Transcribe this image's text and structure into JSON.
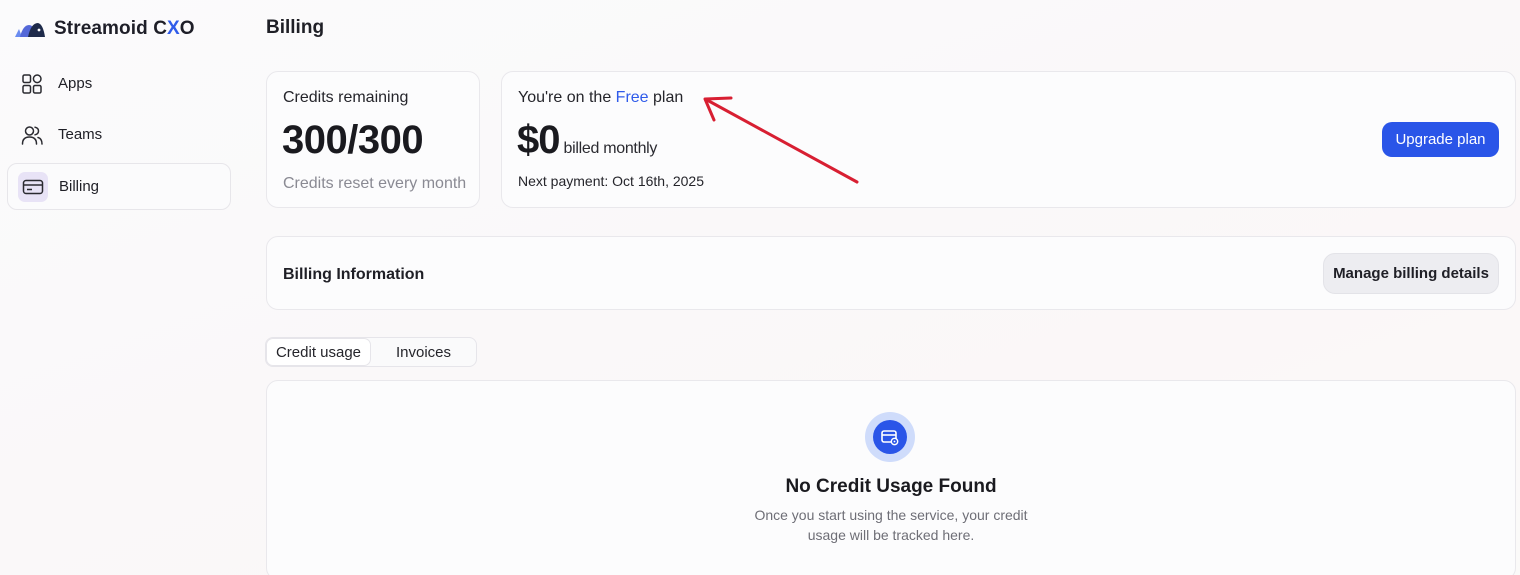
{
  "app": {
    "brand_prefix": "Streamoid C",
    "brand_x": "X",
    "brand_suffix": "O"
  },
  "sidebar": {
    "items": [
      {
        "label": "Apps",
        "icon": "apps-grid-icon"
      },
      {
        "label": "Teams",
        "icon": "users-icon"
      },
      {
        "label": "Billing",
        "icon": "credit-card-icon",
        "active": true
      }
    ]
  },
  "page": {
    "title": "Billing"
  },
  "credits": {
    "label": "Credits remaining",
    "value": "300/300",
    "reset_note": "Credits reset every month"
  },
  "plan": {
    "prefix": "You're on the",
    "name": "Free",
    "suffix": "plan",
    "price": "$0",
    "period": "billed monthly",
    "next_payment": "Next payment: Oct 16th, 2025",
    "upgrade_label": "Upgrade plan"
  },
  "billing_info": {
    "title": "Billing Information",
    "manage_label": "Manage billing details"
  },
  "tabs": [
    {
      "label": "Credit usage",
      "active": true
    },
    {
      "label": "Invoices",
      "active": false
    }
  ],
  "empty_state": {
    "icon": "card-settings-icon",
    "title": "No Credit Usage Found",
    "description": "Once you start using the service, your credit usage will be tracked here."
  },
  "colors": {
    "accent": "#2a55e8",
    "plan_name": "#2f5bea",
    "annotation_arrow": "#d81f32",
    "active_nav_icon_bg": "#e8e3f6"
  }
}
